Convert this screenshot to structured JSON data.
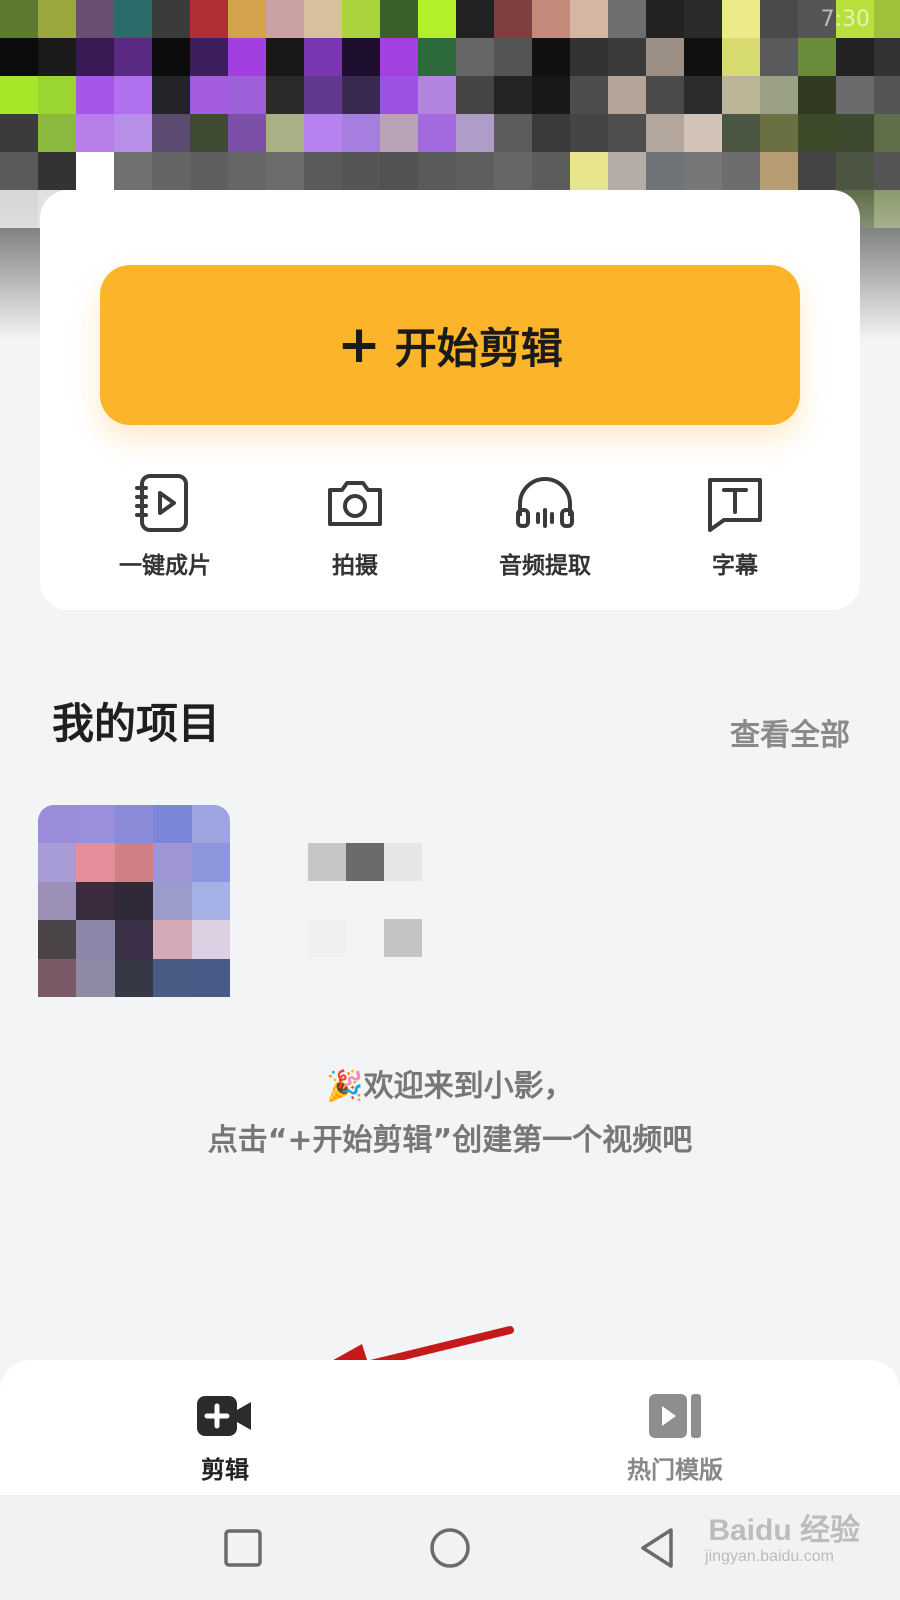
{
  "status_bar": {
    "time_text": "7:30"
  },
  "quick_card": {
    "start_button": {
      "plus": "+",
      "label": "开始剪辑"
    },
    "tools": [
      {
        "label": "一键成片",
        "icon": "auto-video-icon"
      },
      {
        "label": "拍摄",
        "icon": "camera-icon"
      },
      {
        "label": "音频提取",
        "icon": "headphones-icon"
      },
      {
        "label": "字幕",
        "icon": "subtitle-icon"
      }
    ]
  },
  "projects": {
    "title": "我的项目",
    "view_all": "查看全部"
  },
  "welcome": {
    "line1": "🎉欢迎来到小影，",
    "line2": "点击“+开始剪辑”创建第一个视频吧"
  },
  "tabbar": {
    "tabs": [
      {
        "label": "剪辑",
        "icon": "video-add-icon",
        "active": true
      },
      {
        "label": "热门模版",
        "icon": "template-play-icon",
        "active": false
      }
    ]
  },
  "watermark": {
    "brand": "Baidu 经验",
    "url": "jingyan.baidu.com"
  },
  "colors": {
    "accent": "#fcb52a",
    "background": "#f3f4f6",
    "card": "#ffffff",
    "annotation_arrow": "#c41a1a"
  }
}
